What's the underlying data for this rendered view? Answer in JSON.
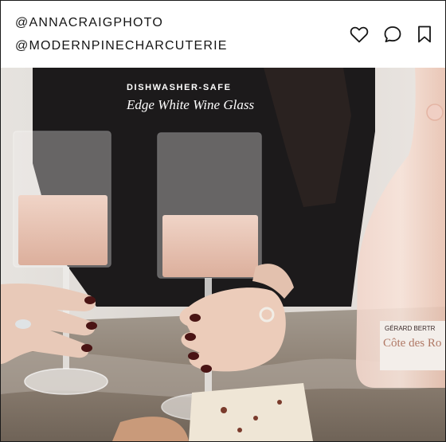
{
  "post": {
    "handle_primary": "@ANNACRAIGPHOTO",
    "handle_secondary": "@MODERNPINECHARCUTERIE"
  },
  "actions": {
    "like_icon": "heart-icon",
    "comment_icon": "comment-icon",
    "save_icon": "bookmark-icon"
  },
  "caption": {
    "kicker": "DISHWASHER-SAFE",
    "title": "Edge White Wine Glass"
  },
  "bottle_label": {
    "brand": "GÉRARD BERTR",
    "name": "Côte des Ro"
  },
  "colors": {
    "text": "#151515",
    "caption": "#ffffff",
    "wine": "#e9c3b3",
    "sweater": "#1c1a1b",
    "nail_polish": "#4a1414"
  }
}
